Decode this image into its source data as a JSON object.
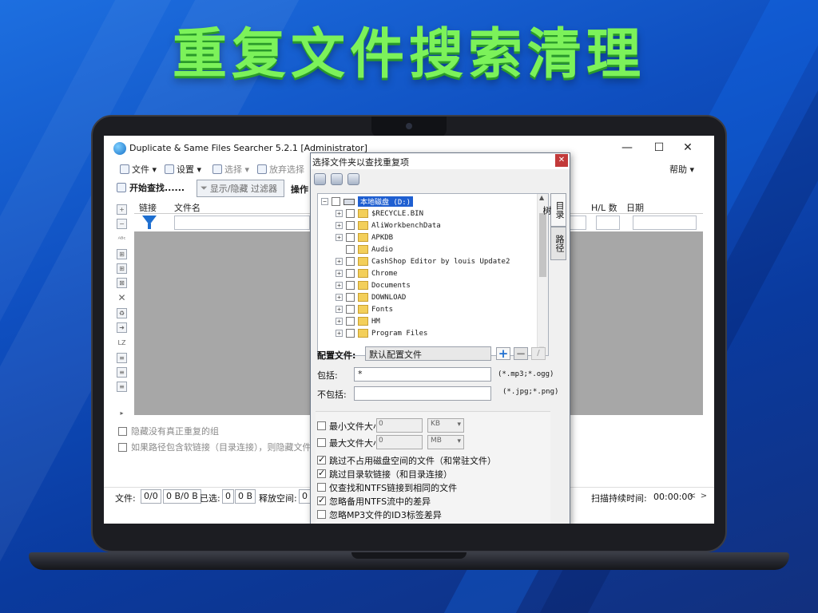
{
  "headline": "重复文件搜索清理",
  "colors": {
    "headline": "#7cf25a",
    "selection": "#1f5fd1",
    "grid": "#a7a7a7"
  },
  "window": {
    "title": "Duplicate & Same Files Searcher 5.2.1 [Administrator]",
    "minimize": "—",
    "maximize": "☐",
    "close": "✕"
  },
  "menu": {
    "file": "文件 ▾",
    "settings": "设置 ▾",
    "select": "选择 ▾",
    "abandon": "放弃选择",
    "help": "帮助 ▾"
  },
  "toolbar": {
    "start": "开始查找......",
    "filter_toggle": "显示/隐藏 过滤器",
    "operations": "操作"
  },
  "grid": {
    "columns": {
      "link": "链接",
      "filename": "文件名",
      "hl_count": "H/L 数",
      "date": "日期"
    }
  },
  "options": {
    "hide_groups": "隐藏没有真正重复的组",
    "hide_links": "如果路径包含软链接（目录连接），则隐藏文件"
  },
  "status": {
    "file_label": "文件:",
    "file_count": "0/0",
    "file_size": "0 B/0 B",
    "selected_label": "已选:",
    "selected_count": "0",
    "selected_size": "0 B",
    "free_label": "释放空间:",
    "free_value": "0",
    "scan_time_label": "扫描持续时间:",
    "scan_time_value": "00:00:00",
    "scroll_left": "<",
    "scroll_right": ">"
  },
  "dialog": {
    "title": "选择文件夹以查找重复项",
    "close": "✕",
    "tabs": {
      "dir_tree": "目录树",
      "path": "路径"
    },
    "tree": {
      "root": "本地磁盘 (D:)",
      "items": [
        "$RECYCLE.BIN",
        "AliWorkbenchData",
        "APKDB",
        "Audio",
        "CashShop Editor by louis Update2",
        "Chrome",
        "Documents",
        "DOWNLOAD",
        "Fonts",
        "HM",
        "Program Files"
      ],
      "expand_minus": "−",
      "expand_plus": "+"
    },
    "config_label": "配置文件:",
    "config_value": "默认配置文件",
    "include_label": "包括:",
    "include_value": "*",
    "include_hint": "(*.mp3;*.ogg)",
    "exclude_label": "不包括:",
    "exclude_value": "",
    "exclude_hint": "(*.jpg;*.png)",
    "min_size_label": "最小文件大小",
    "min_size_value": "0",
    "min_unit": "KB",
    "max_size_label": "最大文件大小",
    "max_size_value": "0",
    "max_unit": "MB",
    "skip_no_space": "跳过不占用磁盘空间的文件（和常驻文件）",
    "skip_dir_links": "跳过目录软链接（和目录连接）",
    "only_ntfs_links": "仅查找和NTFS链接到相同的文件",
    "ignore_ntfs_streams": "忽略备用NTFS流中的差异",
    "ignore_mp3_id3": "忽略MP3文件的ID3标签差异"
  }
}
